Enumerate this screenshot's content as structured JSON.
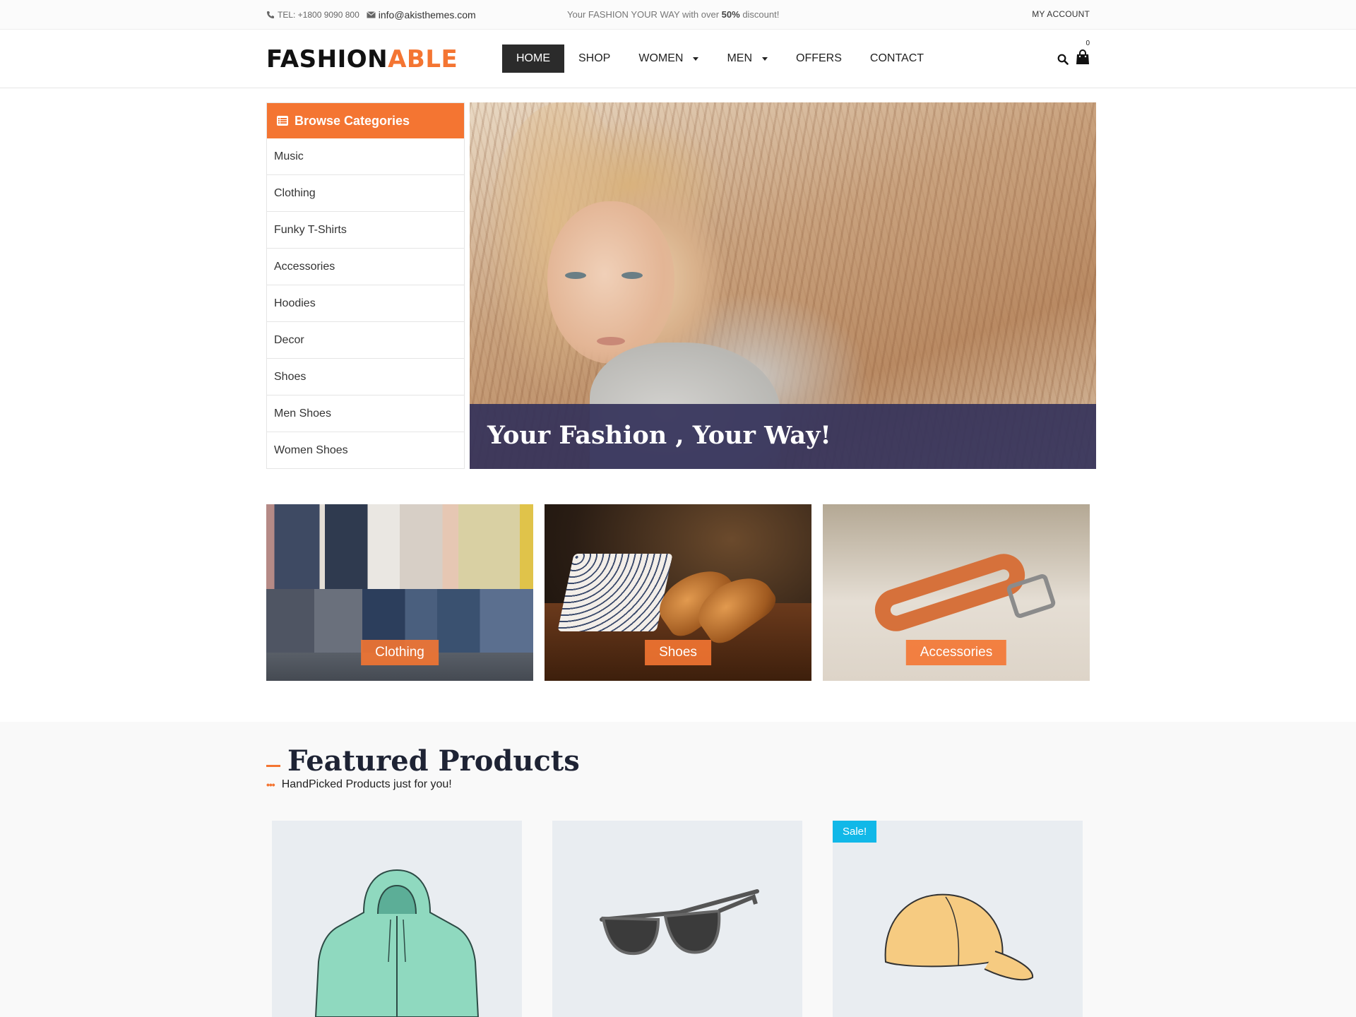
{
  "topbar": {
    "tel": "TEL: +1800 9090 800",
    "email": "info@akisthemes.com",
    "promo_pre": "Your FASHION YOUR WAY with over ",
    "promo_bold": "50%",
    "promo_post": " discount!",
    "account": "MY ACCOUNT"
  },
  "header": {
    "logo_part1": "FASHION",
    "logo_part2": "ABLE",
    "nav": [
      {
        "label": "HOME",
        "active": true
      },
      {
        "label": "SHOP"
      },
      {
        "label": "WOMEN",
        "dropdown": true
      },
      {
        "label": "MEN",
        "dropdown": true
      },
      {
        "label": "OFFERS"
      },
      {
        "label": "CONTACT"
      }
    ],
    "cart_count": "0"
  },
  "sidebar": {
    "title": "Browse Categories",
    "items": [
      "Music",
      "Clothing",
      "Funky T-Shirts",
      "Accessories",
      "Hoodies",
      "Decor",
      "Shoes",
      "Men Shoes",
      "Women Shoes"
    ]
  },
  "hero": {
    "caption": "Your Fashion , Your Way!"
  },
  "categories": [
    {
      "label": "Clothing"
    },
    {
      "label": "Shoes"
    },
    {
      "label": "Accessories"
    }
  ],
  "featured": {
    "title": "Featured Products",
    "subtitle": "HandPicked Products just for you!",
    "products": [
      {
        "image": "hoodie"
      },
      {
        "image": "sunglasses"
      },
      {
        "image": "cap",
        "badge": "Sale!"
      }
    ]
  },
  "colors": {
    "accent": "#f47532",
    "nav_active": "#2b2b2b",
    "hero_caption_bg": "#34325a",
    "sale_badge": "#11b8e8",
    "heading": "#1e2334"
  }
}
